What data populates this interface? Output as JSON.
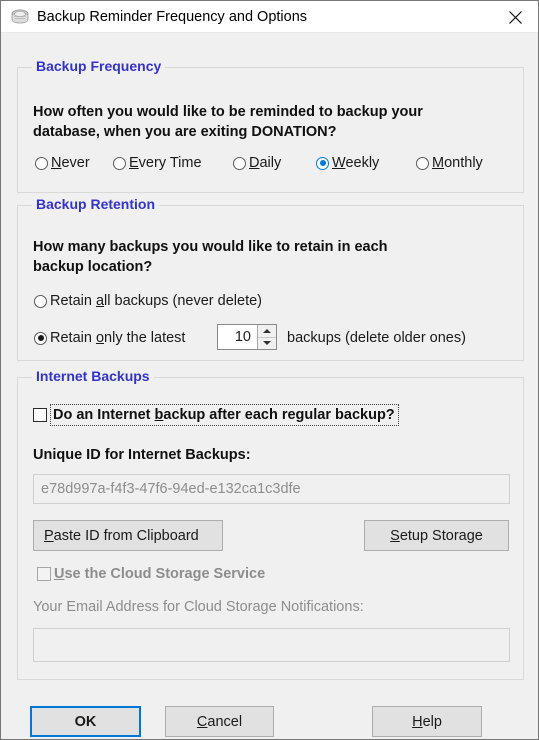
{
  "window": {
    "title": "Backup Reminder Frequency and Options",
    "icon": "backup-drawer-icon",
    "close_label": "✕",
    "accent_color": "#0078d7",
    "legend_color": "#3333cc",
    "background_color": "#f0f0f0"
  },
  "frequency_group": {
    "legend": "Backup Frequency",
    "prompt_line1": "How often you would like to be reminded to backup your",
    "prompt_line2": "database, when you are exiting DONATION?",
    "options": [
      {
        "label": "Never",
        "accel": "N",
        "selected": false
      },
      {
        "label": "Every Time",
        "accel": "E",
        "selected": false
      },
      {
        "label": "Daily",
        "accel": "D",
        "selected": false
      },
      {
        "label": "Weekly",
        "accel": "W",
        "selected": true
      },
      {
        "label": "Monthly",
        "accel": "M",
        "selected": false
      }
    ]
  },
  "retention_group": {
    "legend": "Backup Retention",
    "prompt_line1": "How many backups you would like to retain in each",
    "prompt_line2": "backup location?",
    "option_all": {
      "label_pre": "Retain ",
      "accel": "a",
      "label_post": "ll backups (never delete)",
      "selected": false
    },
    "option_latest": {
      "label_pre": "Retain ",
      "accel": "o",
      "label_post": "nly the latest",
      "selected": true
    },
    "count_value": "10",
    "count_suffix": "backups (delete older ones)"
  },
  "internet_group": {
    "legend": "Internet Backups",
    "do_internet_backup": {
      "label_pre": "Do an Internet ",
      "accel": "b",
      "label_post": "ackup after each regular backup?",
      "checked": false,
      "focused": true
    },
    "unique_id_label": "Unique ID for Internet Backups:",
    "unique_id_value": "e78d997a-f4f3-47f6-94ed-e132ca1c3dfe",
    "paste_button": {
      "label_pre": "",
      "accel": "P",
      "label_post": "aste ID from Clipboard"
    },
    "setup_button": {
      "label_pre": "",
      "accel": "S",
      "label_post": "etup Storage"
    },
    "cloud_checkbox": {
      "label_pre": "",
      "accel": "U",
      "label_post": "se the Cloud Storage Service",
      "checked": false,
      "disabled": true
    },
    "email_label": "Your Email Address for Cloud Storage Notifications:",
    "email_value": "",
    "email_disabled": true
  },
  "footer": {
    "ok": {
      "label": "OK",
      "is_default": true
    },
    "cancel": {
      "label_pre": "",
      "accel": "C",
      "label_post": "ancel"
    },
    "help": {
      "label_pre": "",
      "accel": "H",
      "label_post": "elp"
    }
  }
}
